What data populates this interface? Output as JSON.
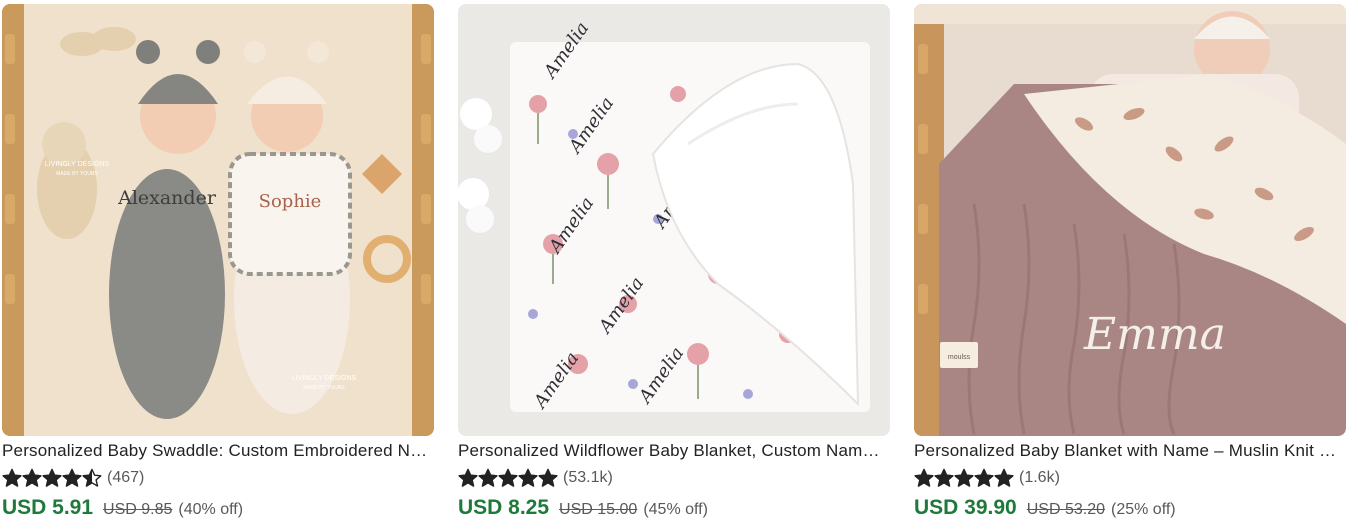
{
  "listings": [
    {
      "title": "Personalized Baby Swaddle: Custom Embroidered Name Swaddle for Newborns",
      "rating": 4.5,
      "reviews": "(467)",
      "price": "USD 5.91",
      "original_price": "USD 9.85",
      "discount": "(40% off)",
      "image_text": {
        "name1": "Alexander",
        "name2": "Sophie",
        "watermark": "LIVINGLY DESIGNS",
        "watermark_sub": "MADE BY YOURS"
      }
    },
    {
      "title": "Personalized Wildflower Baby Blanket, Custom Name Blanket",
      "rating": 5,
      "reviews": "(53.1k)",
      "price": "USD 8.25",
      "original_price": "USD 15.00",
      "discount": "(45% off)",
      "image_text": {
        "name": "Amelia"
      }
    },
    {
      "title": "Personalized Baby Blanket with Name – Muslin Knit Blanket",
      "rating": 5,
      "reviews": "(1.6k)",
      "price": "USD 39.90",
      "original_price": "USD 53.20",
      "discount": "(25% off)",
      "image_text": {
        "name": "Emma",
        "tag": "moulss"
      }
    }
  ],
  "colors": {
    "star": "#222222",
    "sale_price": "#1e7a3a",
    "muted": "#595959"
  }
}
